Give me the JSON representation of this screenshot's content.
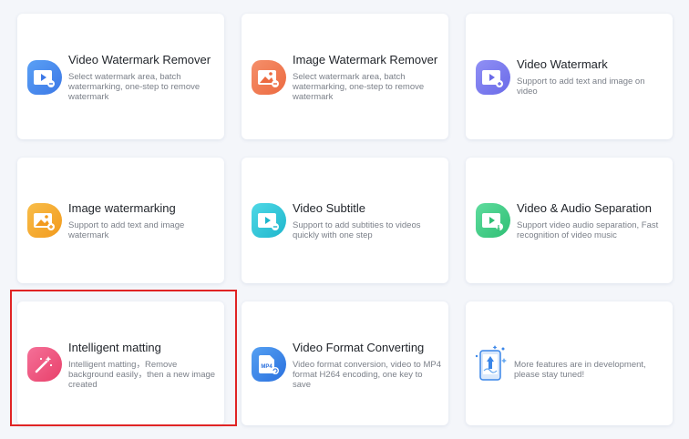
{
  "features": [
    {
      "title": "Video Watermark Remover",
      "desc": "Select watermark area, batch watermarking, one-step to remove watermark",
      "icon": "video-watermark-remover-icon",
      "color": "#4a8cf0"
    },
    {
      "title": "Image Watermark Remover",
      "desc": "Select watermark area, batch watermarking, one-step to remove watermark",
      "icon": "image-watermark-remover-icon",
      "color": "#f07850"
    },
    {
      "title": "Video Watermark",
      "desc": "Support to add text and image on video",
      "icon": "video-watermark-icon",
      "color": "#7c7cf0"
    },
    {
      "title": "Image watermarking",
      "desc": "Support to add text and image watermark",
      "icon": "image-watermarking-icon",
      "color": "#f5a930"
    },
    {
      "title": "Video Subtitle",
      "desc": "Support to add subtities to videos quickly with one step",
      "icon": "video-subtitle-icon",
      "color": "#2fc7d8"
    },
    {
      "title": "Video & Audio Separation",
      "desc": "Support video audio separation, Fast recognition of video music",
      "icon": "video-audio-separation-icon",
      "color": "#3fcf8a"
    },
    {
      "title": "Intelligent matting",
      "desc": "Intelligent matting，Remove background easily，then a new image created",
      "icon": "magic-wand-icon",
      "color": "#f0507a"
    },
    {
      "title": "Video Format Converting",
      "desc": "Video format conversion, video to MP4 format H264 encoding, one key to save",
      "icon": "mp4-file-icon",
      "color": "#3a86e8"
    }
  ],
  "more": {
    "desc": "More features are in development, please stay tuned!",
    "icon": "rocket-phone-icon"
  },
  "mp4_label": "MP4"
}
